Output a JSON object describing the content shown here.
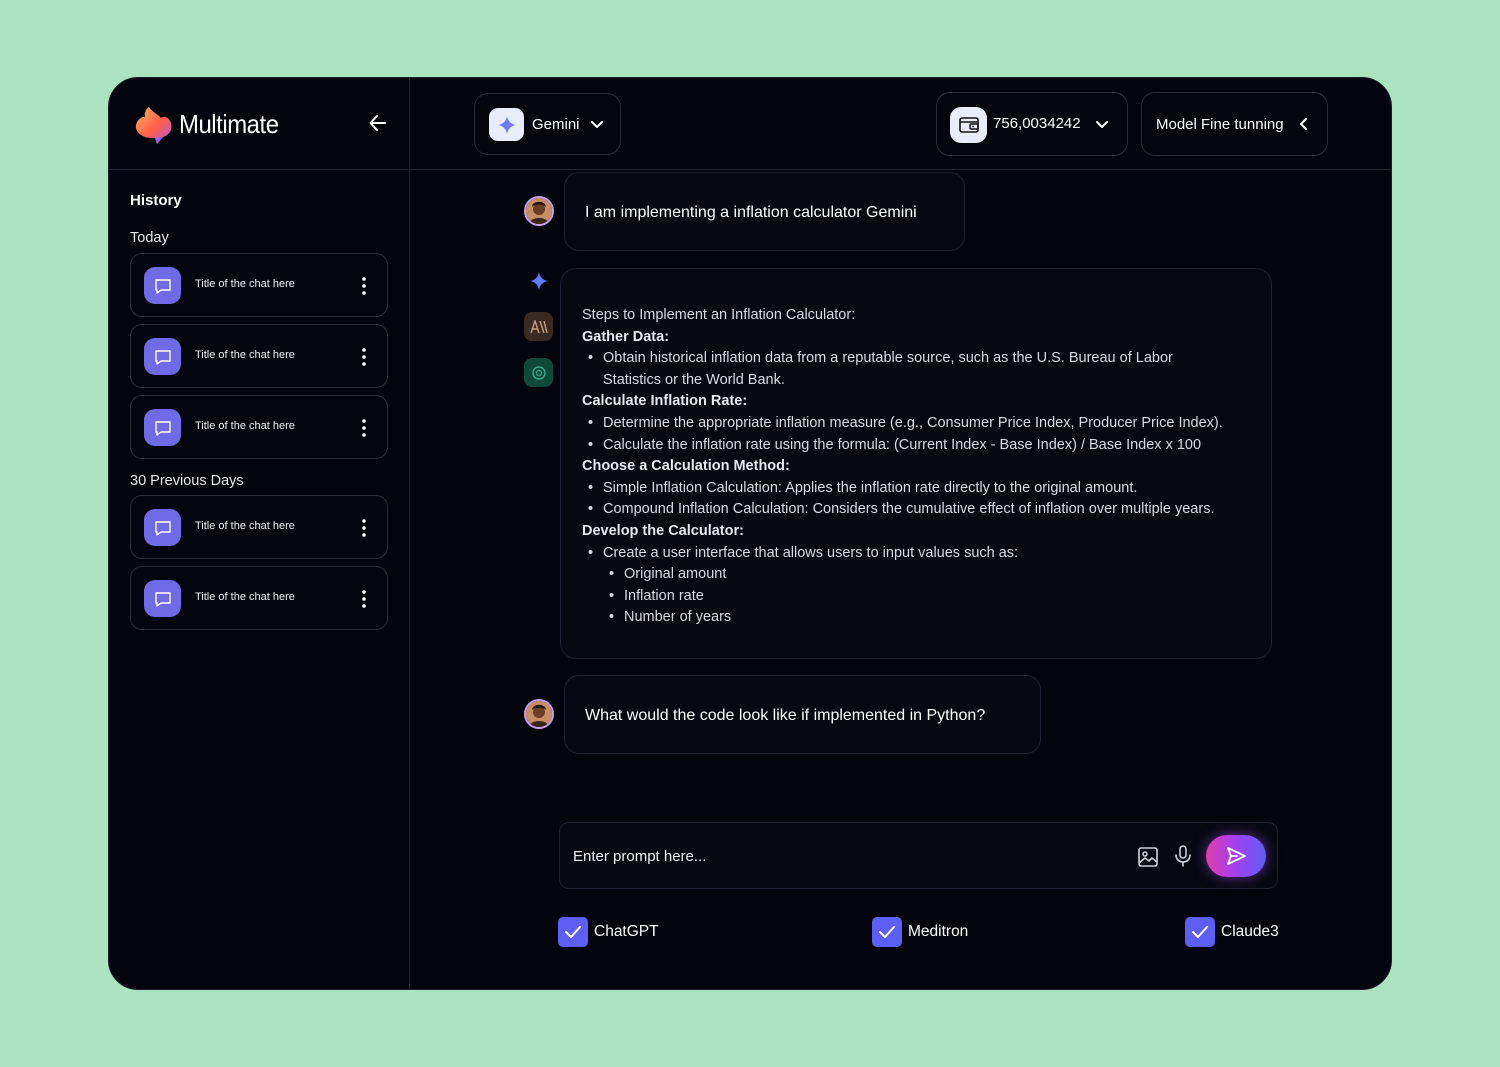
{
  "app": {
    "name": "Multimate"
  },
  "sidebar": {
    "history_title": "History",
    "groups": [
      {
        "label": "Today",
        "items": [
          "Title of the chat here",
          "Title of the chat here",
          "Title of the chat here"
        ]
      },
      {
        "label": "30 Previous Days",
        "items": [
          "Title of the chat here",
          "Title of the chat here"
        ]
      }
    ]
  },
  "header": {
    "model": "Gemini",
    "wallet": "756,0034242",
    "fine_tune": "Model Fine tunning"
  },
  "chat": {
    "user_message_1": "I am implementing a inflation calculator Gemini",
    "answer": {
      "intro": "Steps to Implement an Inflation Calculator:",
      "sections": [
        {
          "heading": "Gather Data:",
          "bullets": [
            "Obtain historical inflation data from a reputable source, such as the U.S. Bureau of Labor Statistics or the World Bank."
          ]
        },
        {
          "heading": "Calculate Inflation Rate:",
          "bullets": [
            "Determine the appropriate inflation measure (e.g., Consumer Price Index, Producer Price Index).",
            "Calculate the inflation rate using the formula: (Current Index - Base Index) / Base Index x 100"
          ]
        },
        {
          "heading": "Choose a Calculation Method:",
          "bullets": [
            "Simple Inflation Calculation: Applies the inflation rate directly to the original amount.",
            "Compound Inflation Calculation: Considers the cumulative effect of inflation over multiple years."
          ]
        },
        {
          "heading": "Develop the Calculator:",
          "bullets": [
            "Create a user interface that allows users to input values such as:"
          ],
          "sub_bullets": [
            "Original amount",
            "Inflation rate",
            "Number of years"
          ]
        }
      ]
    },
    "user_message_2": "What would the code look like if implemented in Python?"
  },
  "composer": {
    "placeholder": "Enter prompt here...",
    "models": [
      {
        "label": "ChatGPT",
        "checked": true
      },
      {
        "label": "Meditron",
        "checked": true
      },
      {
        "label": "Claude3",
        "checked": true
      }
    ]
  },
  "colors": {
    "accent": "#5c5ef5",
    "chat_icon": "#6f6be6",
    "page_bg": "#abe3c0",
    "app_bg": "#03040c"
  }
}
